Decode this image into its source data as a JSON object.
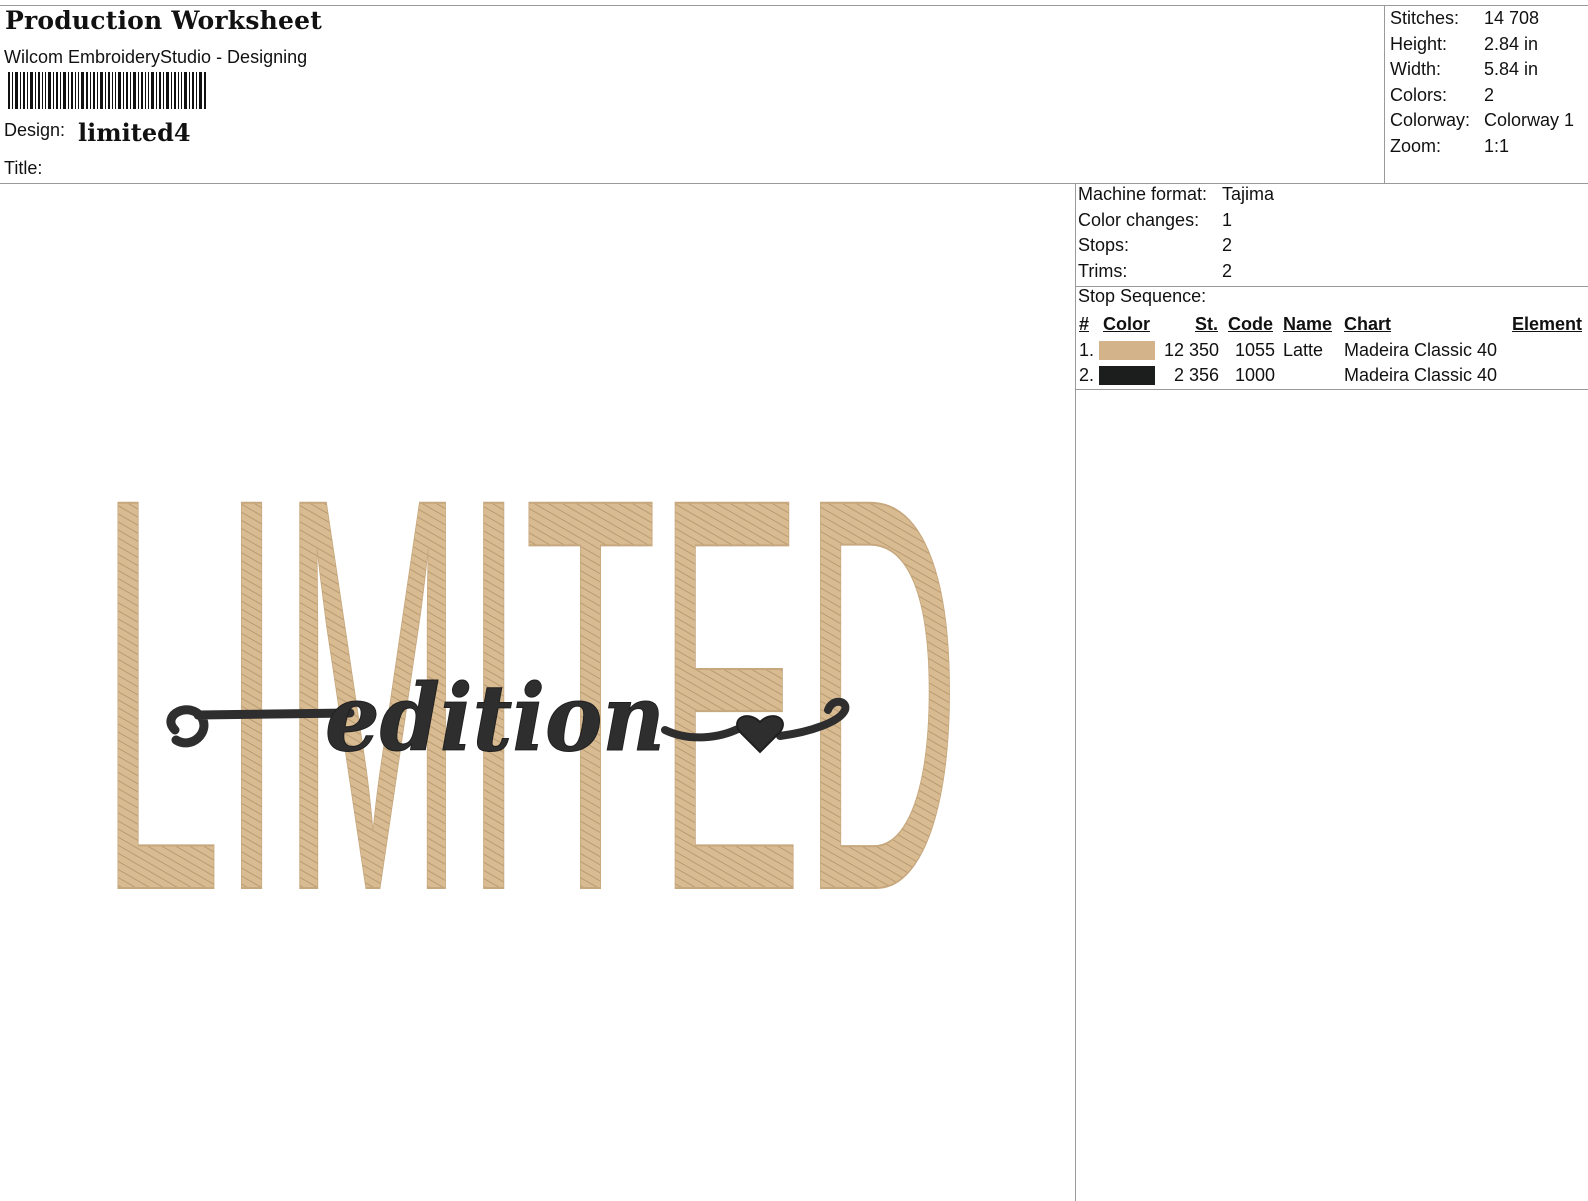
{
  "header": {
    "title": "Production Worksheet",
    "software": "Wilcom EmbroideryStudio - Designing",
    "design_label": "Design:",
    "design_name": "limited4",
    "title_label": "Title:",
    "title_value": ""
  },
  "stats": [
    {
      "label": "Stitches:",
      "value": "14 708"
    },
    {
      "label": "Height:",
      "value": "2.84 in"
    },
    {
      "label": "Width:",
      "value": "5.84 in"
    },
    {
      "label": "Colors:",
      "value": "2"
    },
    {
      "label": "Colorway:",
      "value": "Colorway 1"
    },
    {
      "label": "Zoom:",
      "value": "1:1"
    }
  ],
  "machine": [
    {
      "label": "Machine format:",
      "value": "Tajima"
    },
    {
      "label": "Color changes:",
      "value": "1"
    },
    {
      "label": "Stops:",
      "value": "2"
    },
    {
      "label": "Trims:",
      "value": "2"
    }
  ],
  "stop_sequence": {
    "label": "Stop Sequence:",
    "headers": {
      "num": "#",
      "color": "Color",
      "stitches": "St.",
      "code": "Code",
      "name": "Name",
      "chart": "Chart",
      "element": "Element"
    },
    "rows": [
      {
        "num": "1.",
        "color_hex": "#d3b48a",
        "stitches": "12 350",
        "code": "1055",
        "name": "Latte",
        "chart": "Madeira Classic 40"
      },
      {
        "num": "2.",
        "color_hex": "#1c1e1d",
        "stitches": "2 356",
        "code": "1000",
        "name": "",
        "chart": "Madeira Classic 40"
      }
    ]
  },
  "preview": {
    "main_text": "LIMITED",
    "script_text": "edition",
    "main_color": "#d9bb92",
    "script_color": "#2e2e2e",
    "heart_icon": "heart-icon"
  }
}
